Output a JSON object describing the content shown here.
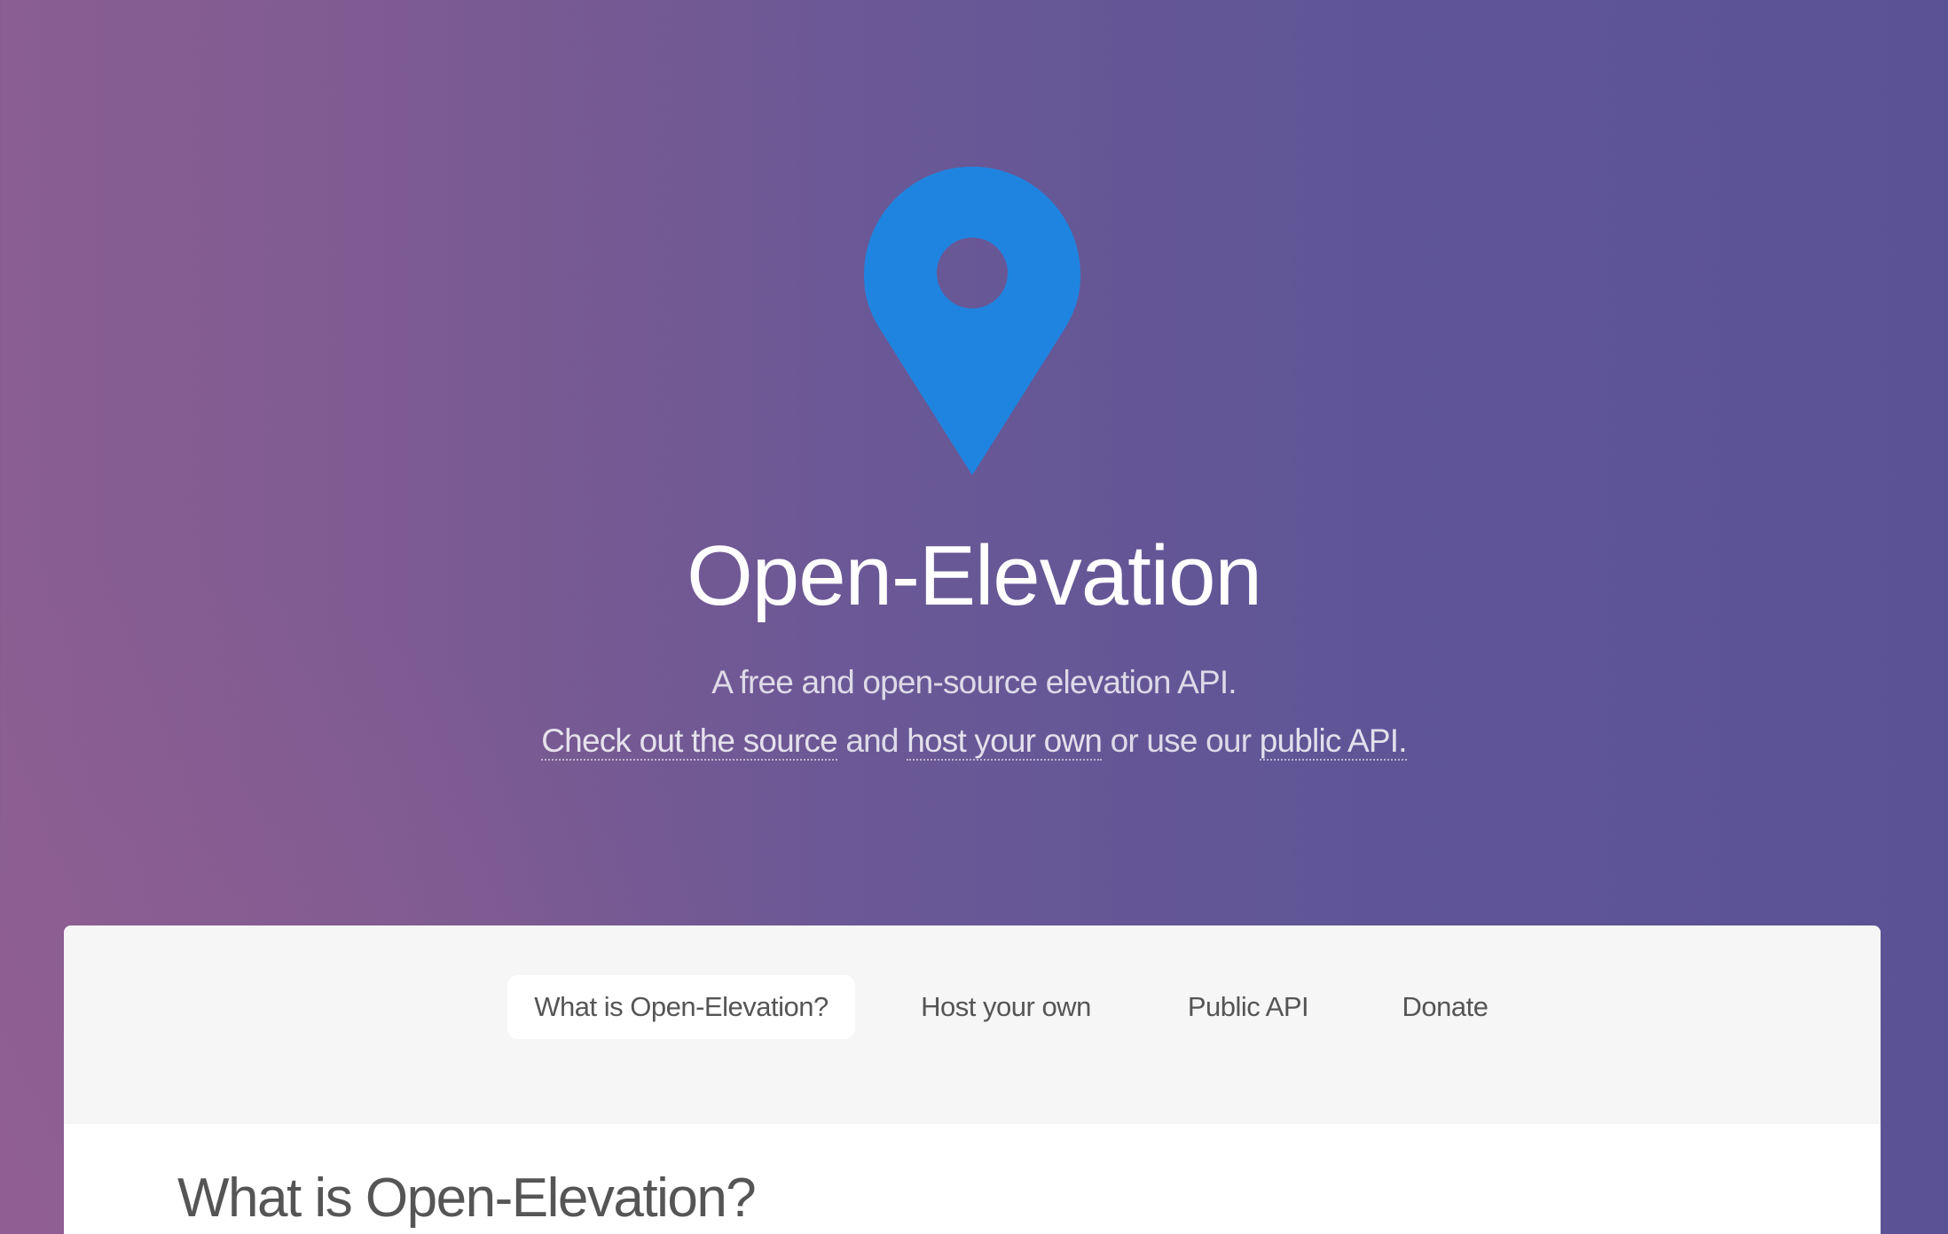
{
  "header": {
    "logo_icon": "map-pin-icon",
    "logo_color": "#1f84e0",
    "title": "Open-Elevation",
    "tagline": "A free and open-source elevation API.",
    "links": {
      "source_label": "Check out the source",
      "and_text": " and ",
      "host_label": "host your own",
      "or_text": " or use our ",
      "api_label": "public API."
    }
  },
  "nav": {
    "items": [
      {
        "label": "What is Open-Elevation?",
        "active": true
      },
      {
        "label": "Host your own",
        "active": false
      },
      {
        "label": "Public API",
        "active": false
      },
      {
        "label": "Donate",
        "active": false
      }
    ]
  },
  "main": {
    "section_title": "What is Open-Elevation?"
  },
  "colors": {
    "gradient_left": "#8a5e92",
    "gradient_right": "#5b5296",
    "nav_background": "#f6f6f6",
    "text_dark": "#555555"
  }
}
